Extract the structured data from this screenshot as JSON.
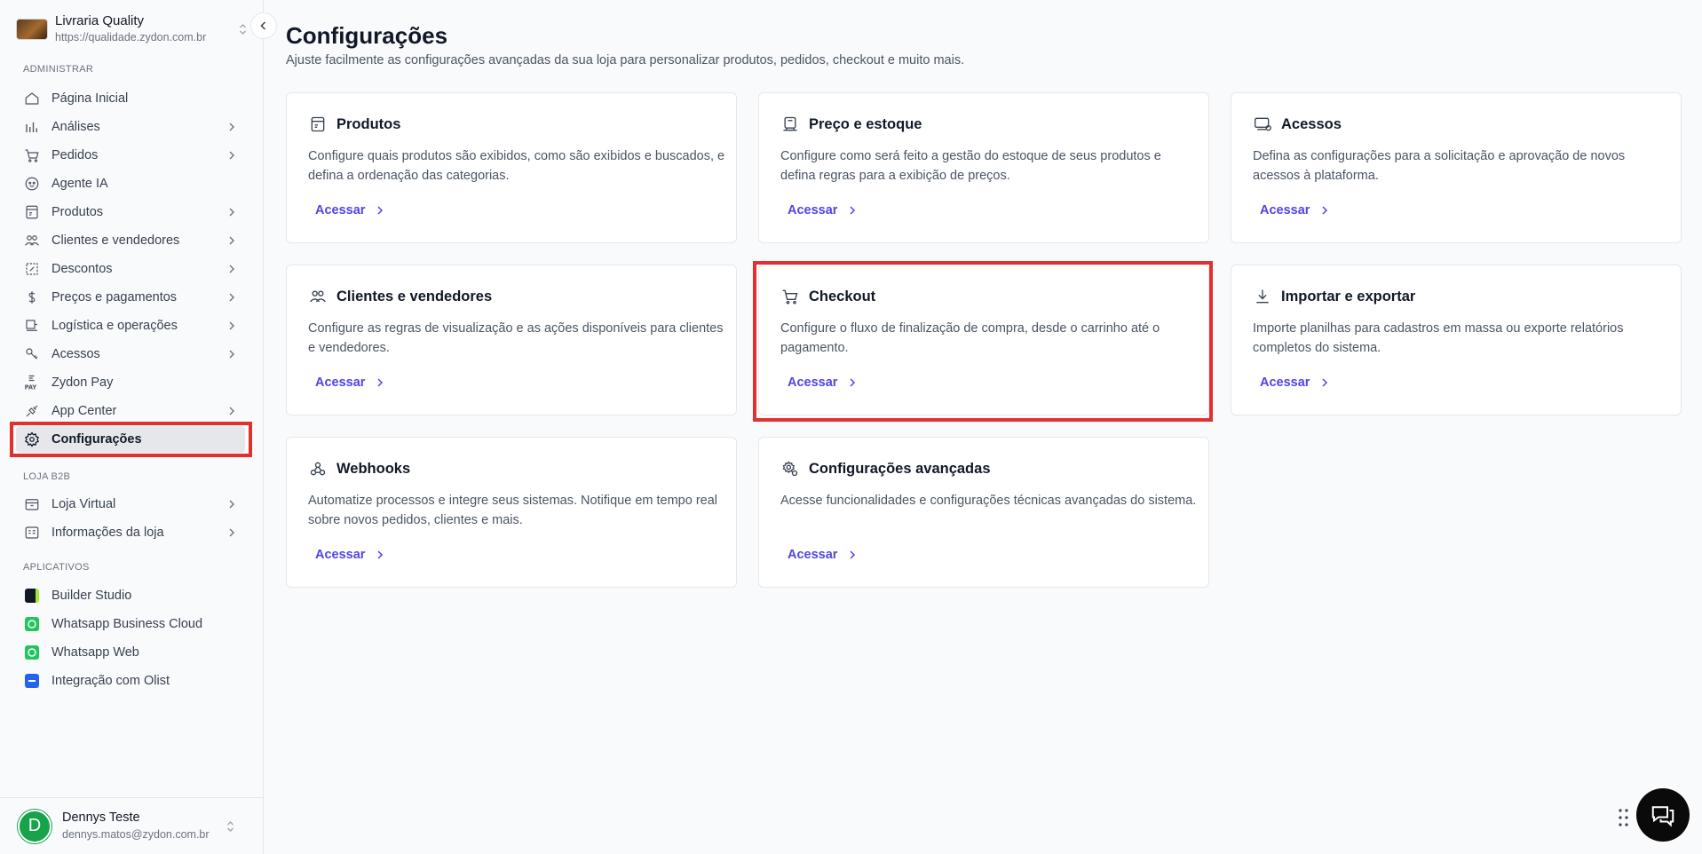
{
  "store": {
    "name": "Livraria Quality",
    "url": "https://qualidade.zydon.com.br"
  },
  "sidebar": {
    "sections": {
      "admin": "ADMINISTRAR",
      "b2b": "LOJA B2B",
      "apps": "APLICATIVOS"
    },
    "admin_items": [
      {
        "label": "Página Inicial",
        "icon": "home-icon",
        "chevron": false
      },
      {
        "label": "Análises",
        "icon": "chart-icon",
        "chevron": true
      },
      {
        "label": "Pedidos",
        "icon": "cart-icon",
        "chevron": true
      },
      {
        "label": "Agente IA",
        "icon": "bot-icon",
        "chevron": false
      },
      {
        "label": "Produtos",
        "icon": "box-icon",
        "chevron": true
      },
      {
        "label": "Clientes e vendedores",
        "icon": "users-icon",
        "chevron": true
      },
      {
        "label": "Descontos",
        "icon": "discount-icon",
        "chevron": true
      },
      {
        "label": "Preços e pagamentos",
        "icon": "dollar-icon",
        "chevron": true
      },
      {
        "label": "Logística e operações",
        "icon": "truck-icon",
        "chevron": true
      },
      {
        "label": "Acessos",
        "icon": "key-icon",
        "chevron": true
      },
      {
        "label": "Zydon Pay",
        "icon": "pay-icon",
        "chevron": false
      },
      {
        "label": "App Center",
        "icon": "plug-icon",
        "chevron": true
      },
      {
        "label": "Configurações",
        "icon": "gear-icon",
        "chevron": false,
        "active": true
      }
    ],
    "b2b_items": [
      {
        "label": "Loja Virtual",
        "icon": "store-icon",
        "chevron": true
      },
      {
        "label": "Informações da loja",
        "icon": "info-card-icon",
        "chevron": true
      }
    ],
    "app_items": [
      {
        "label": "Builder Studio",
        "icon": "builder-studio-icon",
        "color": "#111827"
      },
      {
        "label": "Whatsapp Business Cloud",
        "icon": "whatsapp-icon",
        "color": "#22c55e"
      },
      {
        "label": "Whatsapp Web",
        "icon": "whatsapp-icon",
        "color": "#22c55e"
      },
      {
        "label": "Integração com Olist",
        "icon": "olist-icon",
        "color": "#2563eb"
      }
    ]
  },
  "user": {
    "initial": "D",
    "name": "Dennys Teste",
    "email": "dennys.matos@zydon.com.br",
    "avatar_color": "#16a34a"
  },
  "main": {
    "title": "Configurações",
    "subtitle": "Ajuste facilmente as configurações avançadas da sua loja para personalizar produtos, pedidos, checkout e muito mais.",
    "cards": [
      {
        "title": "Produtos",
        "icon": "box-icon",
        "desc": "Configure quais produtos são exibidos, como são exibidos e buscados, e defina a ordenação das categorias.",
        "link": "Acessar"
      },
      {
        "title": "Preço e estoque",
        "icon": "price-stock-icon",
        "desc": "Configure como será feito a gestão do estoque de seus produtos e defina regras para a exibição de preços.",
        "link": "Acessar"
      },
      {
        "title": "Acessos",
        "icon": "access-icon",
        "desc": "Defina as configurações para a solicitação e aprovação de novos acessos à plataforma.",
        "link": "Acessar"
      },
      {
        "title": "Clientes e vendedores",
        "icon": "users-icon",
        "desc": "Configure as regras de visualização e as ações disponíveis para clientes e vendedores.",
        "link": "Acessar"
      },
      {
        "title": "Checkout",
        "icon": "cart-icon",
        "desc": "Configure o fluxo de finalização de compra, desde o carrinho até o pagamento.",
        "link": "Acessar"
      },
      {
        "title": "Importar e exportar",
        "icon": "download-icon",
        "desc": "Importe planilhas para cadastros em massa ou exporte relatórios completos do sistema.",
        "link": "Acessar"
      },
      {
        "title": "Webhooks",
        "icon": "webhook-icon",
        "desc": "Automatize processos e integre seus sistemas. Notifique em tempo real sobre novos pedidos, clientes e mais.",
        "link": "Acessar"
      },
      {
        "title": "Configurações avançadas",
        "icon": "gear-advanced-icon",
        "desc": "Acesse funcionalidades e configurações técnicas avançadas do sistema.",
        "link": "Acessar"
      }
    ]
  },
  "colors": {
    "accent": "#4f46e5",
    "highlight": "#e03131"
  }
}
